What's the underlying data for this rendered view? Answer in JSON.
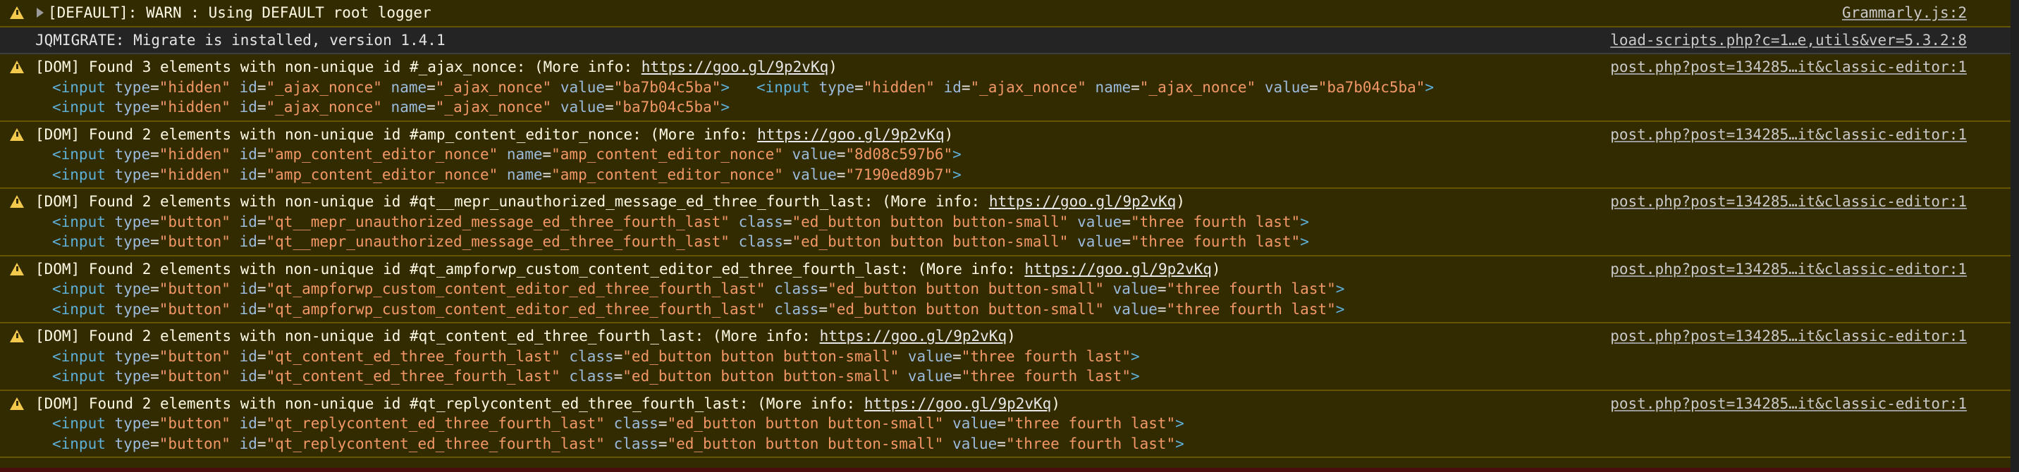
{
  "colors": {
    "warn_bg": "#332b00",
    "warn_border": "#665500",
    "warn_icon": "#f2c94c",
    "tag": "#5db0d7",
    "attr": "#9bbbdc",
    "value": "#f29766"
  },
  "messages": [
    {
      "kind": "warn",
      "icon": "warning-icon",
      "text": "[DEFAULT]: WARN : Using DEFAULT root logger",
      "source": "Grammarly.js:2"
    },
    {
      "kind": "info",
      "text": "JQMIGRATE: Migrate is installed, version 1.4.1",
      "source": "load-scripts.php?c=1…e,utils&ver=5.3.2:8"
    },
    {
      "kind": "warn",
      "icon": "warning-icon",
      "text": "[DOM] Found 3 elements with non-unique id #_ajax_nonce: (More info: ",
      "link": "https://goo.gl/9p2vKq",
      "text_end": ")",
      "source": "post.php?post=134285…it&classic-editor:1",
      "elements": [
        [
          {
            "type": "hidden",
            "id": "_ajax_nonce",
            "name": "_ajax_nonce",
            "value": "ba7b04c5ba"
          },
          {
            "type": "hidden",
            "id": "_ajax_nonce",
            "name": "_ajax_nonce",
            "value": "ba7b04c5ba"
          }
        ],
        [
          {
            "type": "hidden",
            "id": "_ajax_nonce",
            "name": "_ajax_nonce",
            "value": "ba7b04c5ba"
          }
        ]
      ]
    },
    {
      "kind": "warn",
      "icon": "warning-icon",
      "text": "[DOM] Found 2 elements with non-unique id #amp_content_editor_nonce: (More info: ",
      "link": "https://goo.gl/9p2vKq",
      "text_end": ")",
      "source": "post.php?post=134285…it&classic-editor:1",
      "elements": [
        [
          {
            "type": "hidden",
            "id": "amp_content_editor_nonce",
            "name": "amp_content_editor_nonce",
            "value": "8d08c597b6"
          }
        ],
        [
          {
            "type": "hidden",
            "id": "amp_content_editor_nonce",
            "name": "amp_content_editor_nonce",
            "value": "7190ed89b7"
          }
        ]
      ]
    },
    {
      "kind": "warn",
      "icon": "warning-icon",
      "text": "[DOM] Found 2 elements with non-unique id #qt__mepr_unauthorized_message_ed_three_fourth_last: (More info: ",
      "link": "https://goo.gl/9p2vKq",
      "text_end": ")",
      "source": "post.php?post=134285…it&classic-editor:1",
      "elements": [
        [
          {
            "type": "button",
            "id": "qt__mepr_unauthorized_message_ed_three_fourth_last",
            "class": "ed_button button button-small",
            "value": "three fourth last"
          }
        ],
        [
          {
            "type": "button",
            "id": "qt__mepr_unauthorized_message_ed_three_fourth_last",
            "class": "ed_button button button-small",
            "value": "three fourth last"
          }
        ]
      ]
    },
    {
      "kind": "warn",
      "icon": "warning-icon",
      "text": "[DOM] Found 2 elements with non-unique id #qt_ampforwp_custom_content_editor_ed_three_fourth_last: (More info: ",
      "link": "https://goo.gl/9p2vKq",
      "text_end": ")",
      "source": "post.php?post=134285…it&classic-editor:1",
      "elements": [
        [
          {
            "type": "button",
            "id": "qt_ampforwp_custom_content_editor_ed_three_fourth_last",
            "class": "ed_button button button-small",
            "value": "three fourth last"
          }
        ],
        [
          {
            "type": "button",
            "id": "qt_ampforwp_custom_content_editor_ed_three_fourth_last",
            "class": "ed_button button button-small",
            "value": "three fourth last"
          }
        ]
      ]
    },
    {
      "kind": "warn",
      "icon": "warning-icon",
      "text": "[DOM] Found 2 elements with non-unique id #qt_content_ed_three_fourth_last: (More info: ",
      "link": "https://goo.gl/9p2vKq",
      "text_end": ")",
      "source": "post.php?post=134285…it&classic-editor:1",
      "elements": [
        [
          {
            "type": "button",
            "id": "qt_content_ed_three_fourth_last",
            "class": "ed_button button button-small",
            "value": "three fourth last"
          }
        ],
        [
          {
            "type": "button",
            "id": "qt_content_ed_three_fourth_last",
            "class": "ed_button button button-small",
            "value": "three fourth last"
          }
        ]
      ]
    },
    {
      "kind": "warn",
      "icon": "warning-icon",
      "text": "[DOM] Found 2 elements with non-unique id #qt_replycontent_ed_three_fourth_last: (More info: ",
      "link": "https://goo.gl/9p2vKq",
      "text_end": ")",
      "source": "post.php?post=134285…it&classic-editor:1",
      "elements": [
        [
          {
            "type": "button",
            "id": "qt_replycontent_ed_three_fourth_last",
            "class": "ed_button button button-small",
            "value": "three fourth last"
          }
        ],
        [
          {
            "type": "button",
            "id": "qt_replycontent_ed_three_fourth_last",
            "class": "ed_button button button-small",
            "value": "three fourth last"
          }
        ]
      ]
    }
  ]
}
